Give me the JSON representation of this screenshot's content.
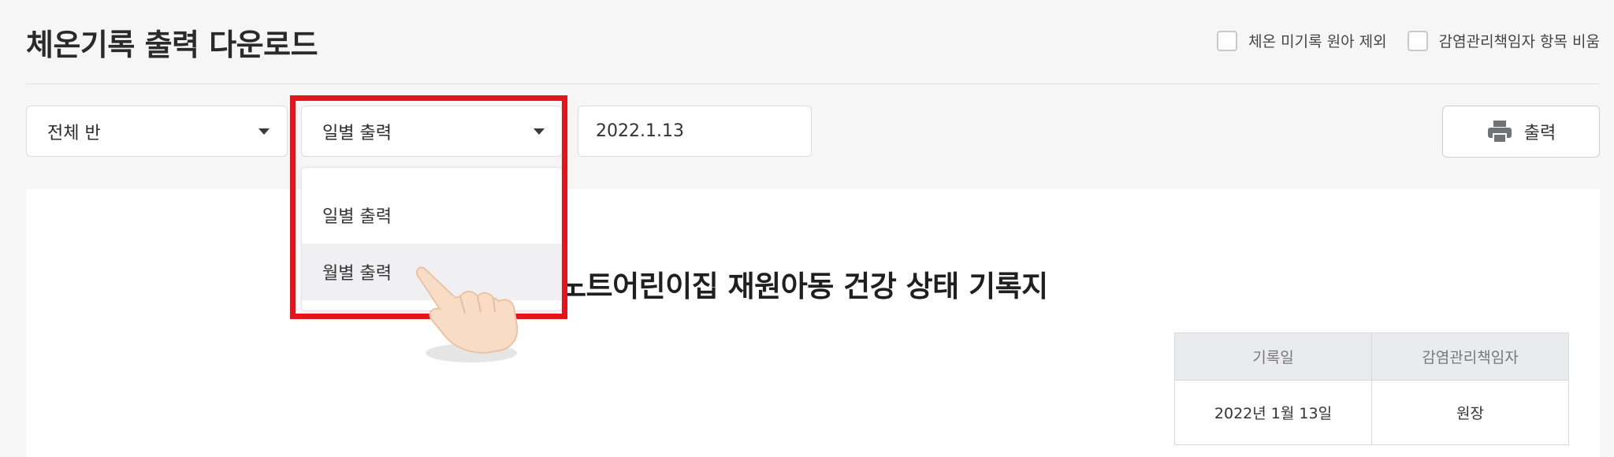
{
  "page": {
    "title": "체온기록 출력 다운로드"
  },
  "options": {
    "exclude_unrecorded_label": "체온 미기록 원아 제외",
    "hide_manager_label": "감염관리책임자 항목 비움"
  },
  "filters": {
    "class_select": "전체 반",
    "mode_select": "일별 출력",
    "date_value": "2022.1.13",
    "mode_options": [
      "일별 출력",
      "월별 출력"
    ]
  },
  "toolbar": {
    "print_label": "출력"
  },
  "document": {
    "title": "노트어린이집 재원아동 건강 상태 기록지",
    "table": {
      "headers": [
        "기록일",
        "감염관리책임자"
      ],
      "row": [
        "2022년 1월 13일",
        "원장"
      ]
    }
  },
  "icons": [
    "calendar-icon",
    "printer-icon",
    "pointing-hand-icon",
    "caret-down-icon"
  ],
  "colors": {
    "highlight": "#e5141b",
    "background": "#f6f6f7"
  }
}
